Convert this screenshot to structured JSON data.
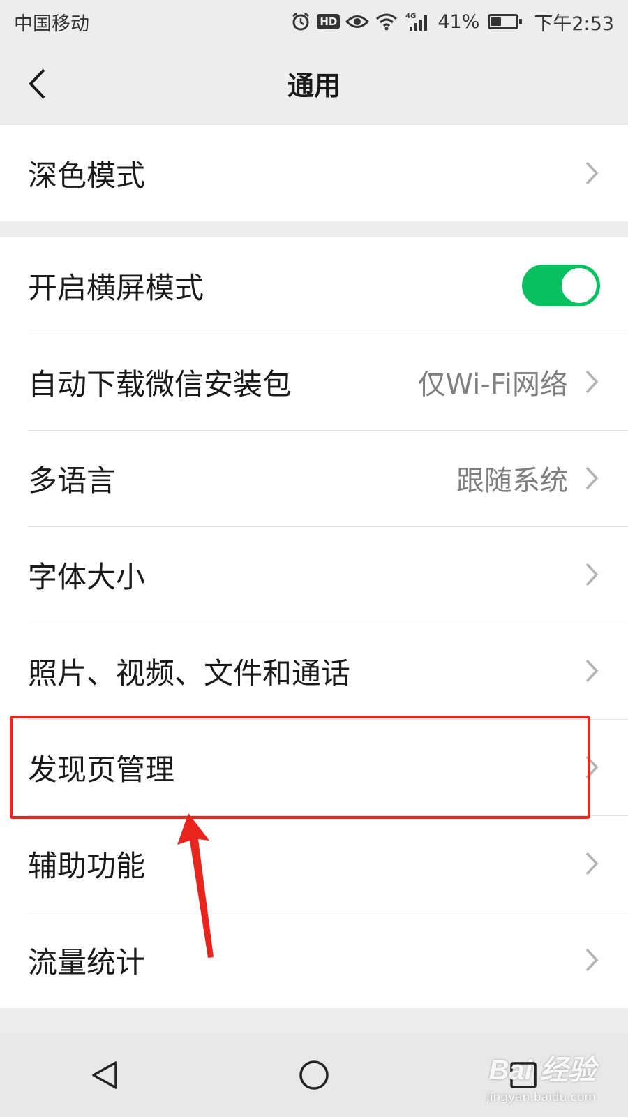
{
  "status_bar": {
    "carrier": "中国移动",
    "hd": "HD",
    "network": "4G",
    "battery_text": "41%",
    "battery_level": 0.41,
    "time": "下午2:53",
    "icons": [
      "alarm-icon",
      "hd-icon",
      "eye-icon",
      "wifi-icon",
      "signal-icon",
      "battery-icon"
    ]
  },
  "nav": {
    "title": "通用",
    "back_icon": "chevron-left-icon"
  },
  "group1": {
    "items": [
      {
        "label": "深色模式"
      }
    ]
  },
  "group2": {
    "items": [
      {
        "label": "开启横屏模式",
        "toggle": true
      },
      {
        "label": "自动下载微信安装包",
        "value": "仅Wi-Fi网络"
      },
      {
        "label": "多语言",
        "value": "跟随系统"
      },
      {
        "label": "字体大小"
      },
      {
        "label": "照片、视频、文件和通话"
      },
      {
        "label": "发现页管理"
      },
      {
        "label": "辅助功能"
      },
      {
        "label": "流量统计"
      }
    ]
  },
  "colors": {
    "toggle_on": "#07c160",
    "annotation": "#e8241c",
    "background": "#ededed"
  },
  "sys_nav": {
    "icons": [
      "back-triangle-icon",
      "home-circle-icon",
      "recents-square-icon"
    ]
  },
  "watermark": {
    "logo": "Bai 经验",
    "url": "jingyan.baidu.com"
  }
}
